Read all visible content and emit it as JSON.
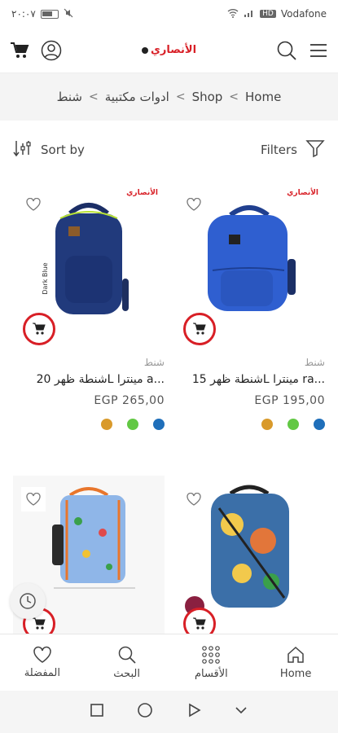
{
  "status_bar": {
    "time": "٢٠:٠٧",
    "carrier": "Vodafone",
    "hd": "HD"
  },
  "header": {
    "logo_text": "الأنصاري"
  },
  "breadcrumb": {
    "items": [
      "Home",
      "Shop",
      "ادوات مكتبية",
      "شنط"
    ],
    "separator": "<"
  },
  "toolbar": {
    "sort_label": "Sort by",
    "filters_label": "Filters"
  },
  "products": [
    {
      "category": "شنط",
      "name": "شنطة ظهر 20L مينترا a...",
      "price": "EGP 265,00",
      "badge": "الأنصاري",
      "image_label": "Dark Blue",
      "swatches": [
        "#1f6fba",
        "#62c844",
        "#d99a2b"
      ]
    },
    {
      "category": "شنط",
      "name": "شنطة ظهر 15L مينترا ra...",
      "price": "EGP 195,00",
      "badge": "الأنصاري",
      "swatches": [
        "#1f6fba",
        "#62c844",
        "#d99a2b"
      ]
    },
    {
      "category": "",
      "name": "",
      "price": ""
    },
    {
      "category": "",
      "name": "",
      "price": ""
    }
  ],
  "bottom_nav": {
    "items": [
      "Home",
      "الأقسام",
      "البحث",
      "المفضلة"
    ]
  },
  "colors": {
    "accent": "#d81f26",
    "bag_navy": "#213a7c",
    "bag_blue": "#2f5fd0"
  }
}
